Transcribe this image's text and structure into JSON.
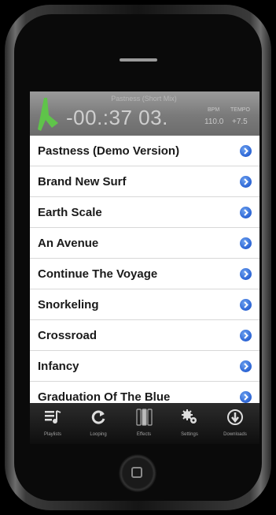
{
  "header": {
    "track_title": "Pastness (Short Mix)",
    "time": "-00.:37 03.",
    "bpm_label": "BPM",
    "tempo_label": "TEMPO",
    "bpm_value": "110.0",
    "tempo_value": "+7.5"
  },
  "tracks": [
    {
      "label": "Pastness (Demo Version)"
    },
    {
      "label": "Brand New Surf"
    },
    {
      "label": "Earth Scale"
    },
    {
      "label": "An Avenue"
    },
    {
      "label": "Continue The Voyage"
    },
    {
      "label": "Snorkeling"
    },
    {
      "label": "Crossroad"
    },
    {
      "label": "Infancy"
    },
    {
      "label": "Graduation Of The Blue"
    }
  ],
  "tabs": [
    {
      "label": "Playlists",
      "icon": "playlist-icon"
    },
    {
      "label": "Looping",
      "icon": "loop-icon"
    },
    {
      "label": "Effects",
      "icon": "effects-icon"
    },
    {
      "label": "Settings",
      "icon": "gear-icon"
    },
    {
      "label": "Downloads",
      "icon": "download-icon"
    }
  ],
  "colors": {
    "accent_green": "#5fc44a",
    "disclosure_blue": "#2a63d4"
  }
}
